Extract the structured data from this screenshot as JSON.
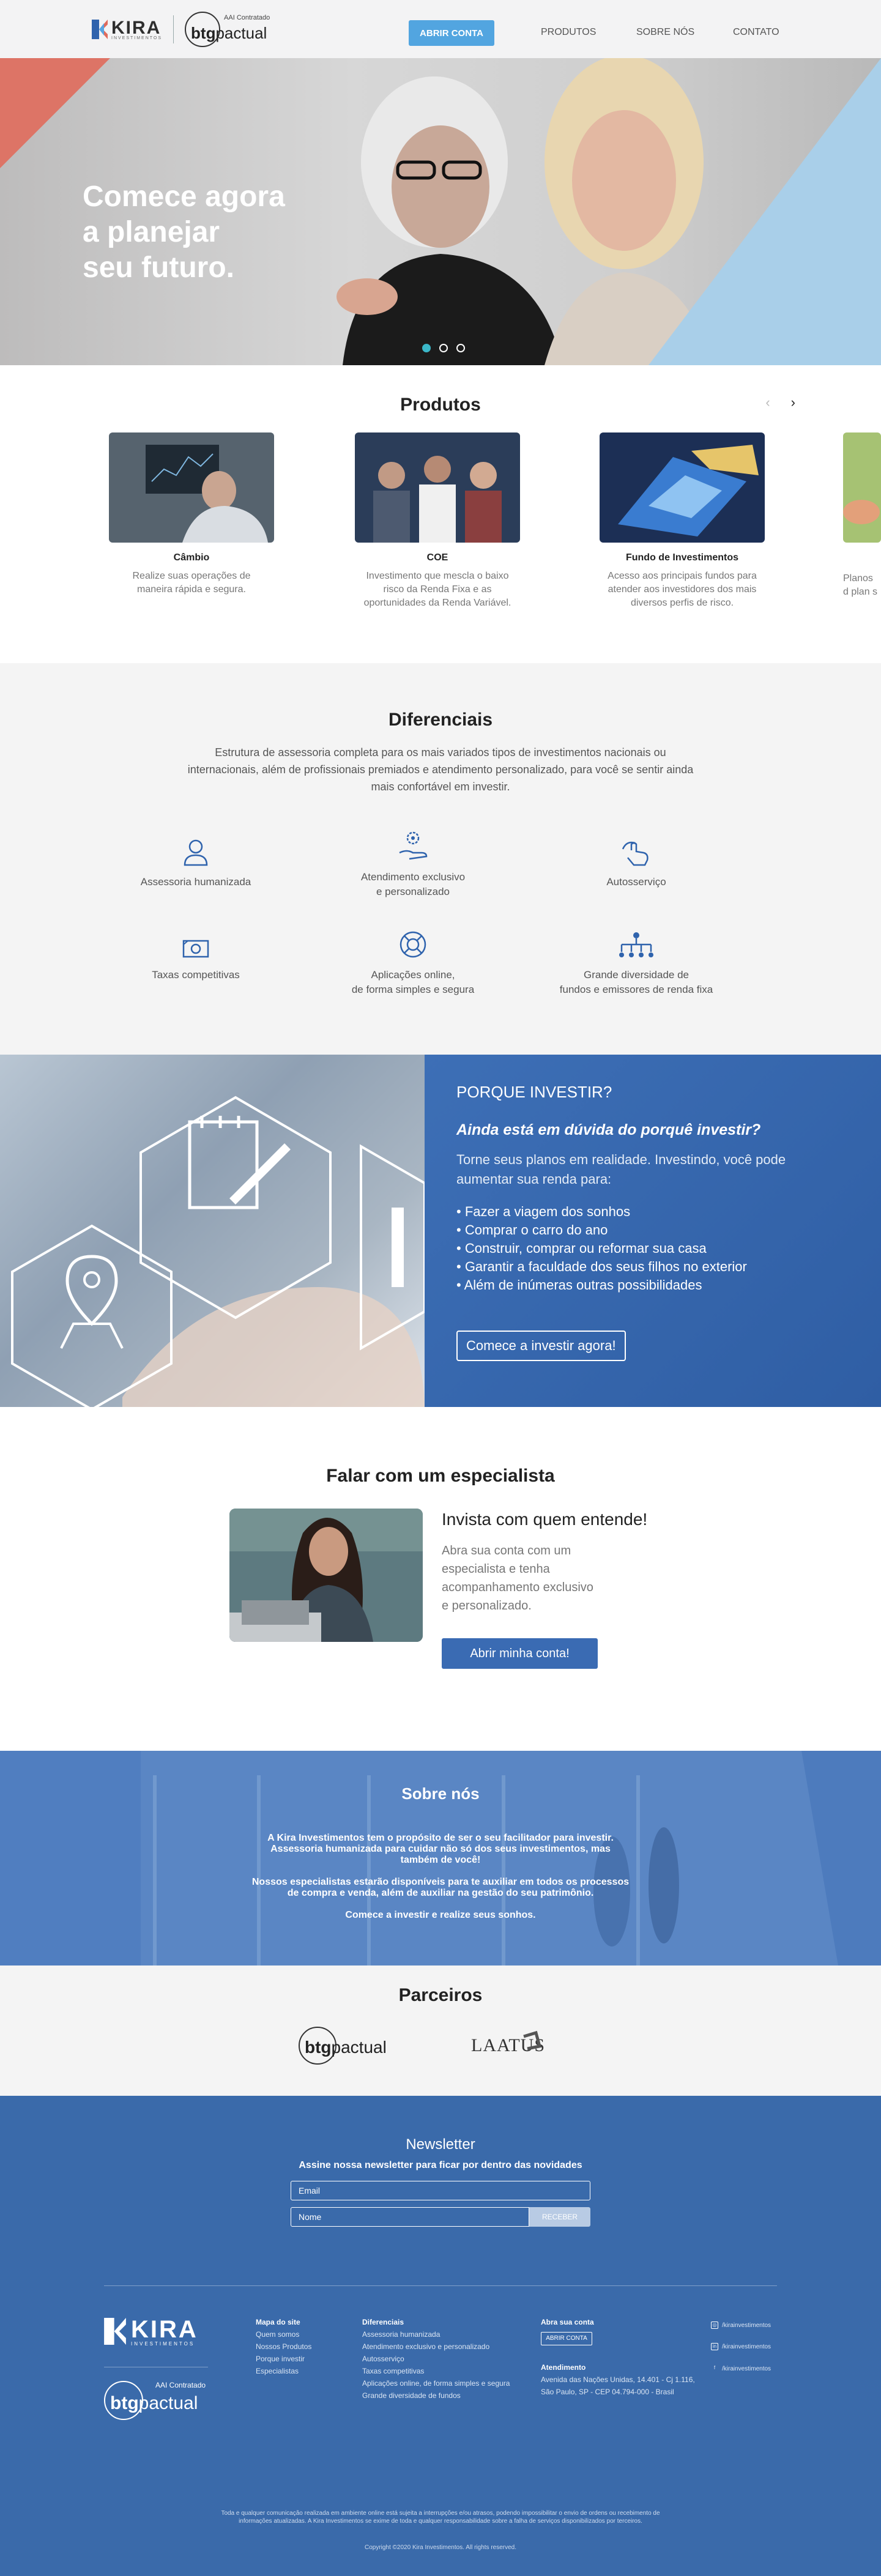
{
  "nav": {
    "kira": "KIRA",
    "kira_sub": "INVESTIMENTOS",
    "btg_small": "AAI Contratado",
    "btg_word_a": "btg",
    "btg_word_b": "pactual",
    "cta": "ABRIR CONTA",
    "links": [
      "PRODUTOS",
      "SOBRE NÓS",
      "CONTATO"
    ]
  },
  "hero": {
    "title_lines": [
      "Comece agora",
      "a planejar",
      "seu futuro."
    ],
    "slides": 3,
    "active": 0
  },
  "produtos": {
    "title": "Produtos",
    "cards": [
      {
        "name": "Câmbio",
        "desc": "Realize suas operações de maneira rápida e segura."
      },
      {
        "name": "COE",
        "desc": "Investimento que mescla o baixo risco da Renda Fixa e as oportunidades da Renda Variável."
      },
      {
        "name": "Fundo de Investimentos",
        "desc": "Acesso aos principais fundos para atender aos investidores dos mais diversos perfis de risco."
      },
      {
        "name": "",
        "desc": "Planos d plan s"
      }
    ]
  },
  "diferenciais": {
    "title": "Diferenciais",
    "intro": "Estrutura de assessoria completa para os mais variados tipos de investimentos nacionais ou internacionais, além de profissionais premiados e atendimento personalizado, para você se sentir ainda mais confortável em investir.",
    "items": [
      {
        "label": "Assessoria humanizada",
        "icon": "user-icon"
      },
      {
        "label": "Atendimento exclusivo\ne personalizado",
        "icon": "hand-gear-icon"
      },
      {
        "label": "Autosserviço",
        "icon": "touch-icon"
      },
      {
        "label": "Taxas competitivas",
        "icon": "money-icon"
      },
      {
        "label": "Aplicações online,\nde forma simples e segura",
        "icon": "lifebuoy-icon"
      },
      {
        "label": "Grande diversidade de\nfundos e emissores de renda fixa",
        "icon": "network-icon"
      }
    ],
    "icon_color": "#2f63ad"
  },
  "porque": {
    "kicker": "PORQUE INVESTIR?",
    "question": "Ainda está em dúvida do porquê investir?",
    "text": "Torne seus planos em realidade. Investindo, você pode aumentar sua renda para:",
    "list": [
      "• Fazer a viagem dos sonhos",
      "• Comprar o carro do ano",
      "• Construir, comprar ou reformar sua casa",
      "• Garantir a faculdade dos seus filhos no exterior",
      "• Além de inúmeras outras possibilidades"
    ],
    "button": "Comece a investir agora!"
  },
  "especialista": {
    "title": "Falar com um especialista",
    "heading": "Invista com quem entende!",
    "text": "Abra sua conta com um especialista e tenha acompanhamento exclusivo e personalizado.",
    "button": "Abrir minha conta!"
  },
  "sobre": {
    "title": "Sobre nós",
    "p1a": "A Kira Investimentos tem o propósito de ser o seu facilitador para investir.",
    "p1b": "Assessoria humanizada para cuidar não só dos seus investimentos, mas",
    "p1c": "também de você!",
    "p2a": "Nossos especialistas estarão disponíveis para te auxiliar em todos os processos",
    "p2b": "de compra e venda, além de auxiliar na gestão do seu patrimônio.",
    "p3": "Comece a investir e realize seus sonhos."
  },
  "parceiros": {
    "title": "Parceiros",
    "btg_a": "btg",
    "btg_b": "pactual",
    "laatus": "LAATUS"
  },
  "newsletter": {
    "title": "Newsletter",
    "sub": "Assine nossa newsletter para ficar por dentro das novidades",
    "email_placeholder": "Email",
    "name_placeholder": "Nome",
    "button": "RECEBER"
  },
  "footer": {
    "kira": "KIRA",
    "kira_sub": "INVESTIMENTOS",
    "btg_small": "AAI Contratado",
    "btg_a": "btg",
    "btg_b": "pactual",
    "mapa_title": "Mapa do site",
    "mapa": [
      "Quem somos",
      "Nossos Produtos",
      "Porque investir",
      "Especialistas"
    ],
    "dif_title": "Diferenciais",
    "dif": [
      "Assessoria humanizada",
      "Atendimento exclusivo e personalizado",
      "Autosserviço",
      "Taxas competitivas",
      "Aplicações online, de forma simples e segura",
      "Grande diversidade de fundos"
    ],
    "abra_title": "Abra sua conta",
    "abra_btn": "ABRIR CONTA",
    "atend_title": "Atendimento",
    "addr1": "Avenida das Nações Unidas, 14.401 - Cj 1.116,",
    "addr2": "São Paulo, SP - CEP 04.794-000 - Brasil",
    "social": [
      "/kirainvestimentos",
      "/kirainvestimentos",
      "/kirainvestimentos"
    ],
    "disclaimer": "Toda e qualquer comunicação realizada em ambiente online está sujeita a interrupções e/ou atrasos, podendo impossibilitar o envio de ordens ou recebimento de informações atualizadas. A Kira Investimentos se exime de toda e qualquer responsabilidade sobre a falha de serviços disponibilizados por terceiros.",
    "copyright": "Copyright ©2020 Kira Investimentos. All rights reserved."
  },
  "colors": {
    "brand_blue": "#3a6aaa",
    "cta_light_blue": "#52a5e0",
    "accent_red": "#e06b5c",
    "accent_teal": "#3bb7c8"
  }
}
